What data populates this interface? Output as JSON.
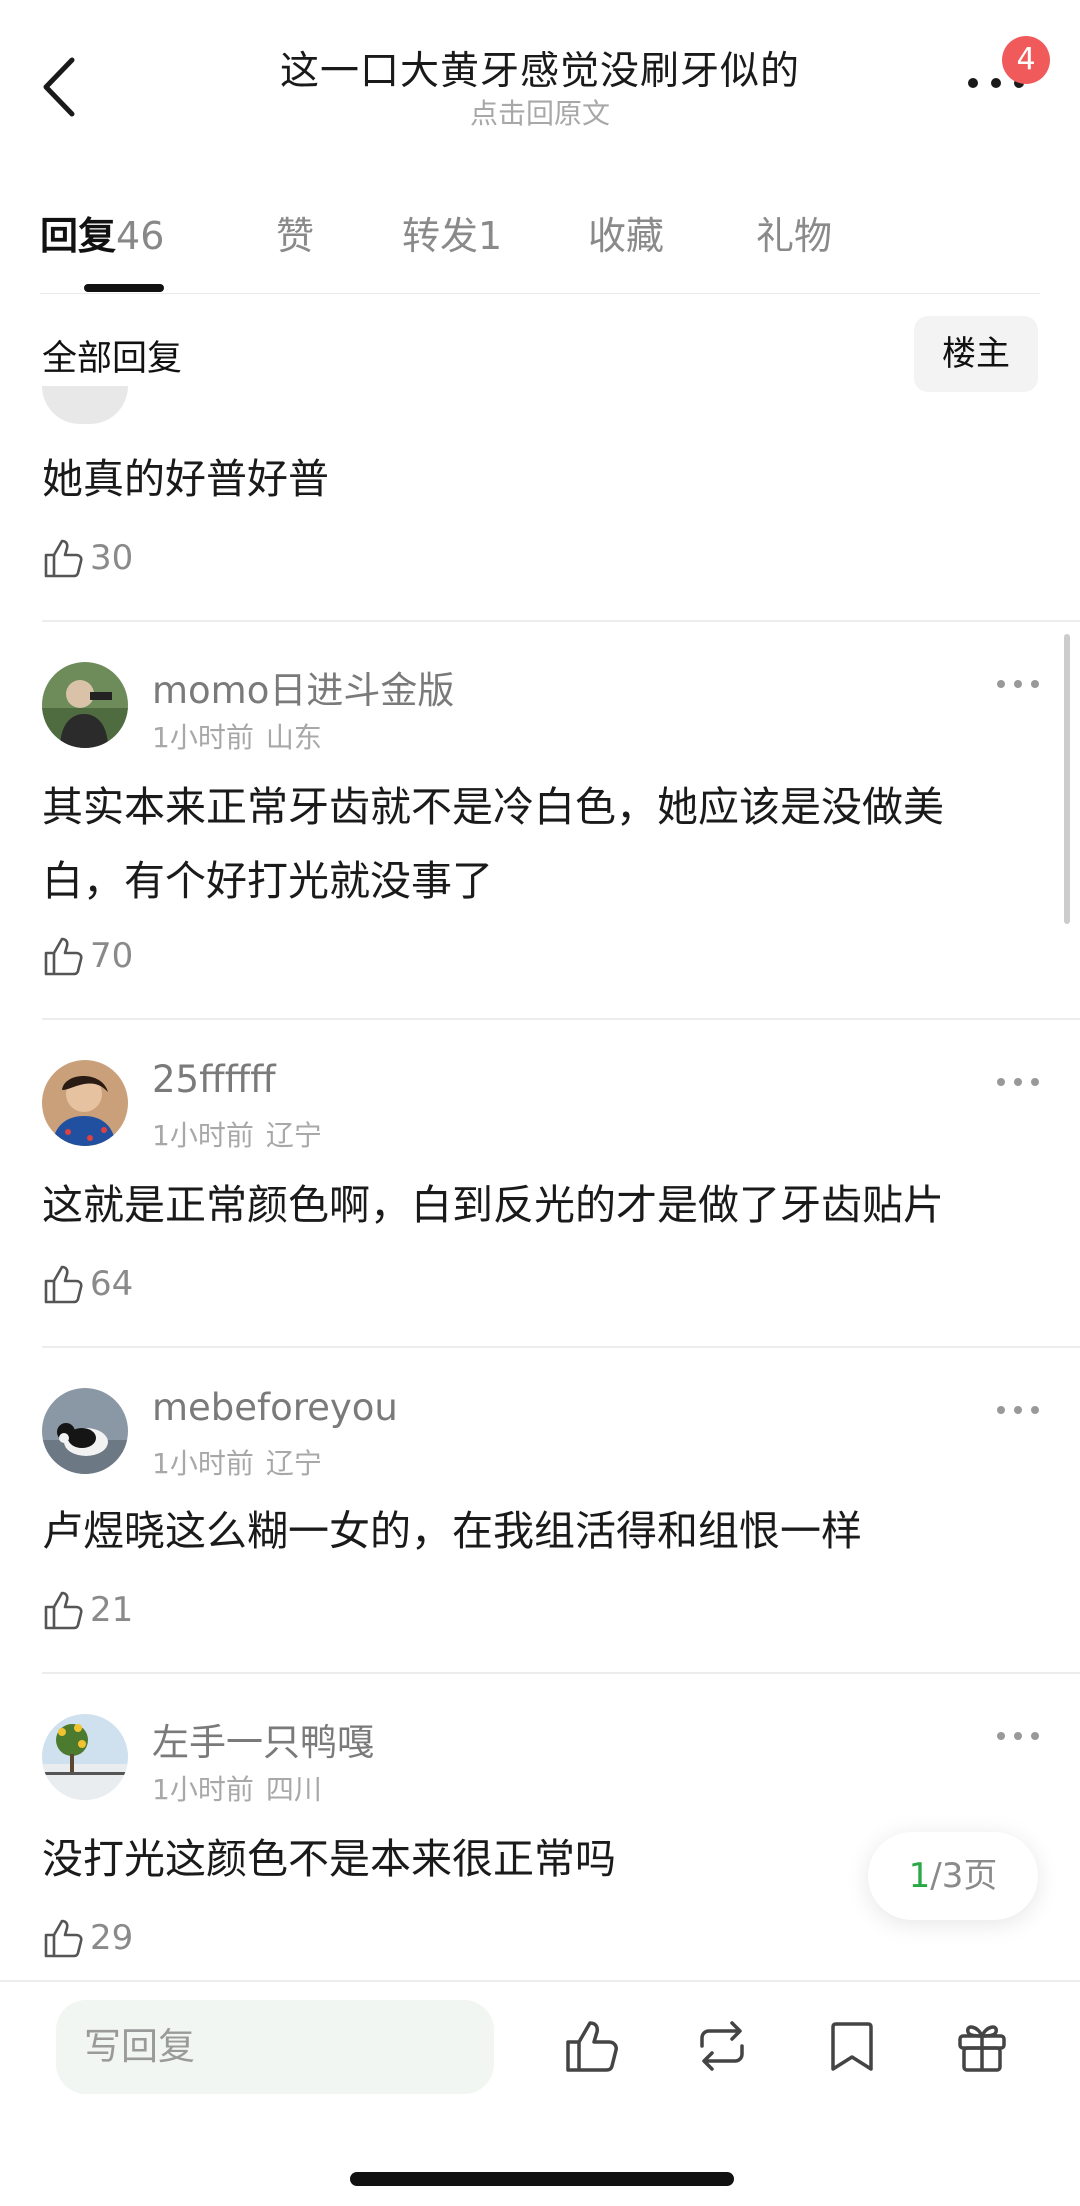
{
  "header": {
    "title": "这一口大黄牙感觉没刷牙似的",
    "subtitle": "点击回原文",
    "badge": "4"
  },
  "tabs": [
    {
      "label": "回复",
      "count": "46"
    },
    {
      "label": "赞"
    },
    {
      "label": "转发",
      "count": "1"
    },
    {
      "label": "收藏"
    },
    {
      "label": "礼物"
    }
  ],
  "filter": {
    "label": "全部回复",
    "owner_button": "楼主"
  },
  "comments": [
    {
      "text": "她真的好普好普",
      "likes": "30"
    },
    {
      "username": "momo日进斗金版",
      "time": "1小时前",
      "location": "山东",
      "text": "其实本来正常牙齿就不是冷白色，她应该是没做美白，有个好打光就没事了",
      "likes": "70"
    },
    {
      "username": "25ffffff",
      "time": "1小时前",
      "location": "辽宁",
      "text": "这就是正常颜色啊，白到反光的才是做了牙齿贴片",
      "likes": "64"
    },
    {
      "username": "mebeforeyou",
      "time": "1小时前",
      "location": "辽宁",
      "text": "卢煜晓这么糊一女的，在我组活得和组恨一样",
      "likes": "21"
    },
    {
      "username": "左手一只鸭嘎",
      "time": "1小时前",
      "location": "四川",
      "text": "没打光这颜色不是本来很正常吗",
      "likes": "29"
    }
  ],
  "pager": {
    "current": "1",
    "total": "/3页"
  },
  "bottom_bar": {
    "reply_placeholder": "写回复"
  }
}
